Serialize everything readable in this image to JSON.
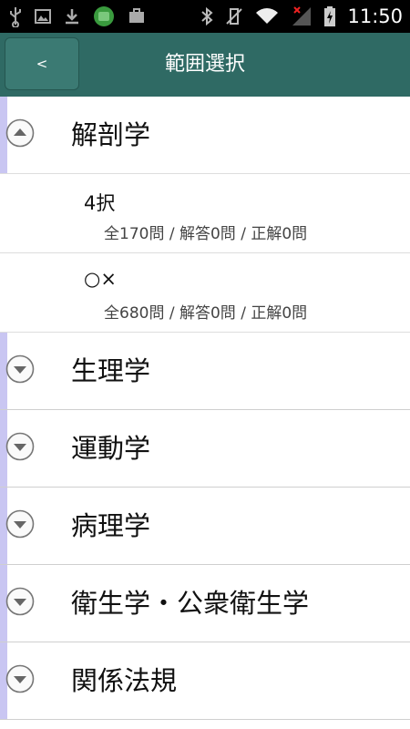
{
  "status_bar": {
    "time": "11:50",
    "icons": [
      "usb-icon",
      "image-icon",
      "download-icon",
      "app-notification-icon",
      "briefcase-icon",
      "bluetooth-icon",
      "vibrate-icon",
      "wifi-icon",
      "signal-icon",
      "battery-icon"
    ]
  },
  "header": {
    "back_label": "<",
    "title": "範囲選択"
  },
  "groups": [
    {
      "label": "解剖学",
      "expanded": true,
      "children": [
        {
          "title": "4択",
          "stats": "全170問 / 解答0問 / 正解0問"
        },
        {
          "title": "○×",
          "stats": "全680問 / 解答0問 / 正解0問"
        }
      ]
    },
    {
      "label": "生理学",
      "expanded": false
    },
    {
      "label": "運動学",
      "expanded": false
    },
    {
      "label": "病理学",
      "expanded": false
    },
    {
      "label": "衛生学・公衆衛生学",
      "expanded": false
    },
    {
      "label": "関係法規",
      "expanded": false
    }
  ],
  "colors": {
    "header_bg": "#2f6a64",
    "accent_bar": "#c9c6f2",
    "status_bar_bg": "#000000"
  }
}
